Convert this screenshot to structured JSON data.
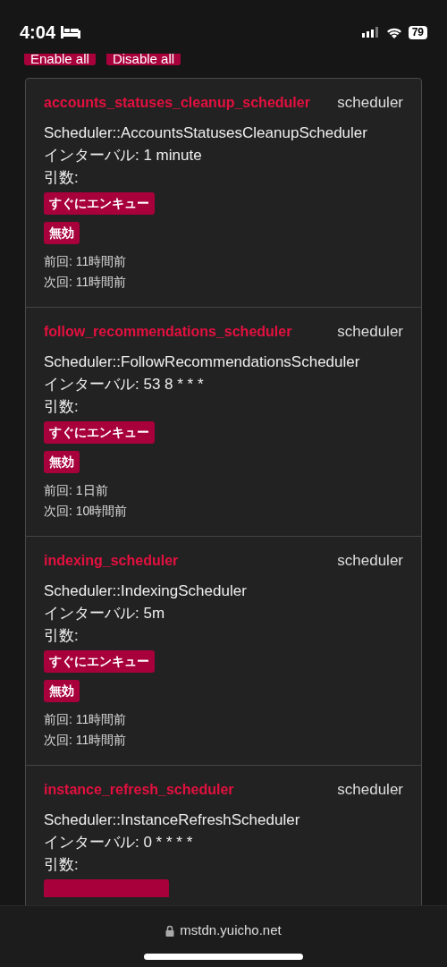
{
  "status_bar": {
    "time": "4:04",
    "battery": "79"
  },
  "toolbar": {
    "buttons": [
      "Enable all",
      "Disable all"
    ]
  },
  "jobs": [
    {
      "name": "accounts_statuses_cleanup_scheduler",
      "queue": "scheduler",
      "class": "Scheduler::AccountsStatusesCleanupScheduler",
      "interval": "インターバル: 1 minute",
      "args": "引数:",
      "enqueue_button": "すぐにエンキュー",
      "toggle_button": "無効",
      "last_run": "前回: 11時間前",
      "next_run": "次回: 11時間前"
    },
    {
      "name": "follow_recommendations_scheduler",
      "queue": "scheduler",
      "class": "Scheduler::FollowRecommendationsScheduler",
      "interval": "インターバル: 53 8 * * *",
      "args": "引数:",
      "enqueue_button": "すぐにエンキュー",
      "toggle_button": "無効",
      "last_run": "前回: 1日前",
      "next_run": "次回: 10時間前"
    },
    {
      "name": "indexing_scheduler",
      "queue": "scheduler",
      "class": "Scheduler::IndexingScheduler",
      "interval": "インターバル: 5m",
      "args": "引数:",
      "enqueue_button": "すぐにエンキュー",
      "toggle_button": "無効",
      "last_run": "前回: 11時間前",
      "next_run": "次回: 11時間前"
    },
    {
      "name": "instance_refresh_scheduler",
      "queue": "scheduler",
      "class": "Scheduler::InstanceRefreshScheduler",
      "interval": "インターバル: 0 * * * *",
      "args": "引数:"
    }
  ],
  "address_bar": {
    "url": "mstdn.yuicho.net"
  }
}
